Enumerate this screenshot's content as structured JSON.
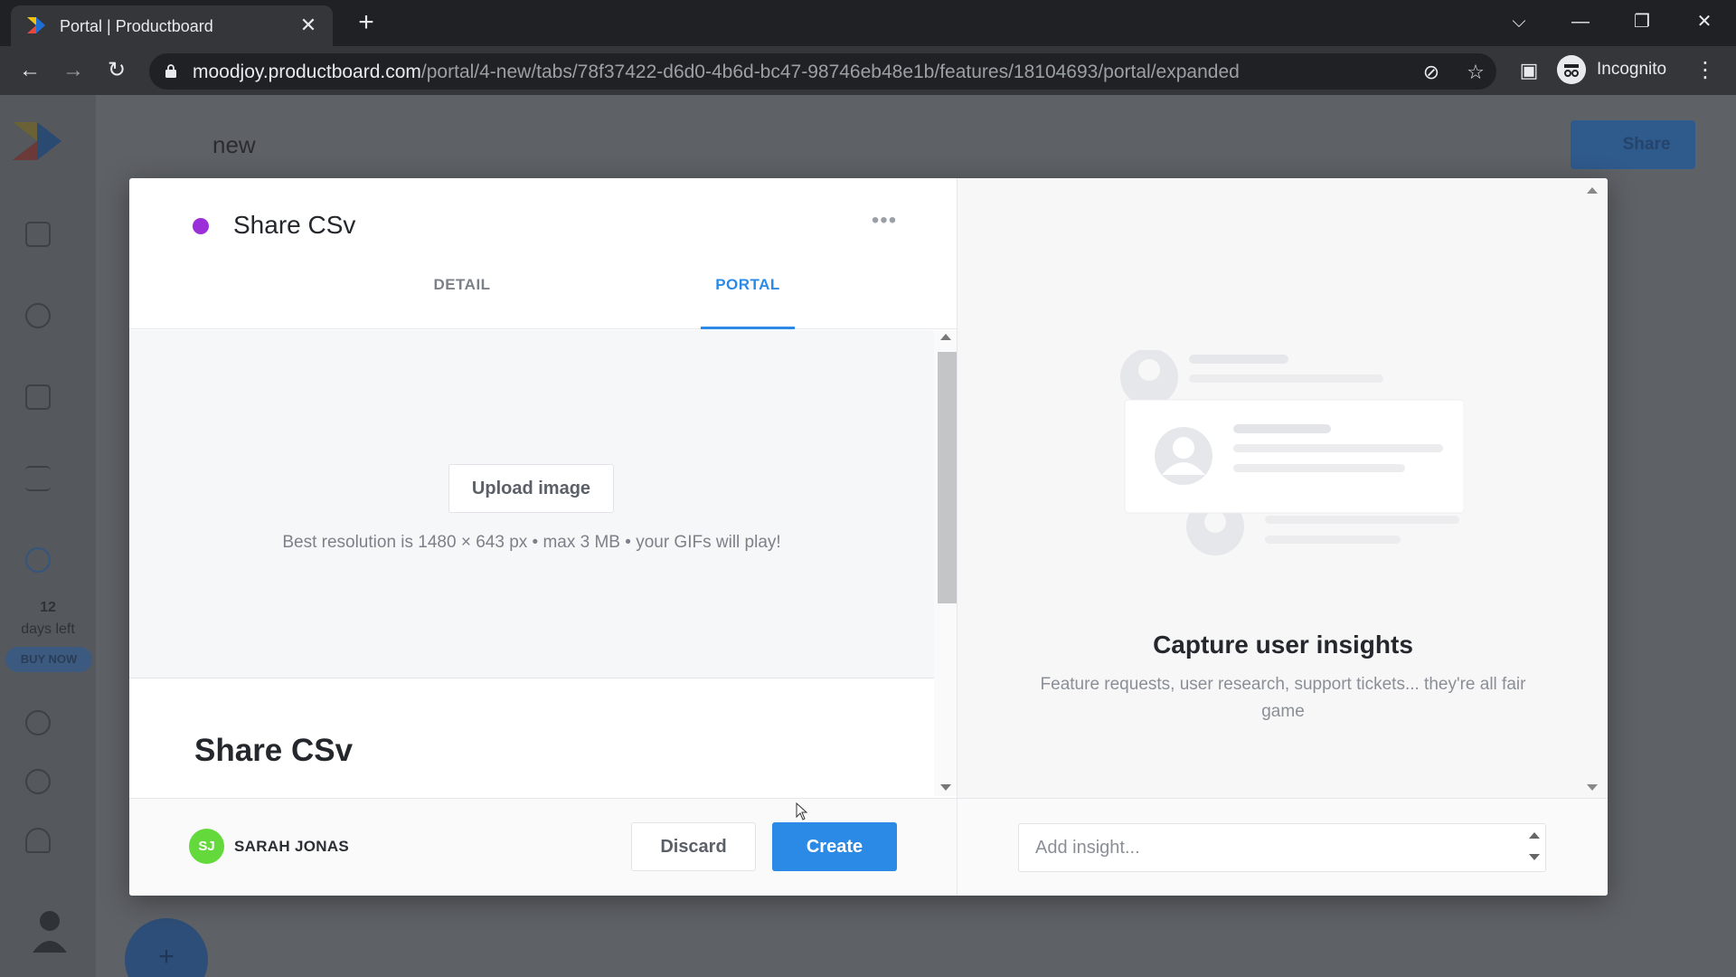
{
  "browser": {
    "tab_title": "Portal | Productboard",
    "url_host": "moodjoy.productboard.com",
    "url_path": "/portal/4-new/tabs/78f37422-d6d0-4b6d-bc47-98746eb48e1b/features/18104693/portal/expanded",
    "profile_label": "Incognito"
  },
  "app": {
    "board_title": "new",
    "share_label": "Share",
    "trial_days": "12",
    "trial_label": "days left",
    "buy_now_label": "BUY NOW",
    "fab_label": "+"
  },
  "modal": {
    "feature_title": "Share CSv",
    "status_color": "#9b30d9",
    "more_label": "•••",
    "tabs": [
      {
        "label": "DETAIL",
        "active": false
      },
      {
        "label": "PORTAL",
        "active": true
      }
    ],
    "upload_label": "Upload image",
    "upload_hint": "Best resolution is 1480 × 643 px • max 3 MB • your GIFs will play!",
    "card_title": "Share CSv",
    "footer": {
      "user_initials": "SJ",
      "user_name": "SARAH JONAS",
      "discard_label": "Discard",
      "create_label": "Create"
    },
    "insights": {
      "title": "Capture user insights",
      "description": "Feature requests, user research, support tickets... they're all fair game",
      "input_placeholder": "Add insight..."
    }
  },
  "colors": {
    "accent": "#2b8ae6",
    "avatar": "#63d93b"
  }
}
